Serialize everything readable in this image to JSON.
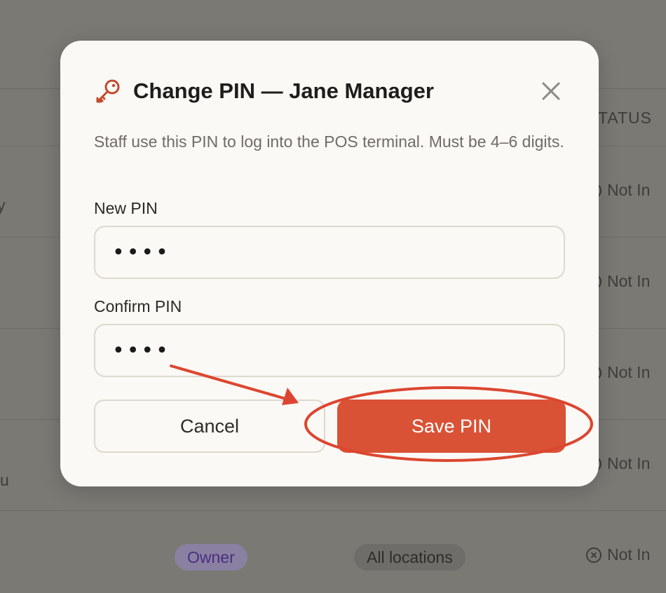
{
  "background": {
    "table_header_status": "TATUS",
    "status_label": "Not In",
    "row_fragment_1": "y",
    "row_fragment_2": "u",
    "role_badge": "Owner",
    "location_badge": "All locations"
  },
  "modal": {
    "title": "Change PIN — Jane Manager",
    "description": "Staff use this PIN to log into the POS terminal. Must be 4–6 digits.",
    "new_pin_label": "New PIN",
    "new_pin_value": "1234",
    "confirm_pin_label": "Confirm PIN",
    "confirm_pin_value": "1234",
    "cancel_label": "Cancel",
    "save_label": "Save PIN",
    "icons": {
      "title": "key-icon",
      "close": "close-icon"
    }
  },
  "colors": {
    "accent": "#d95235",
    "annotation": "#dc4630",
    "overlay": "#7b7974"
  }
}
